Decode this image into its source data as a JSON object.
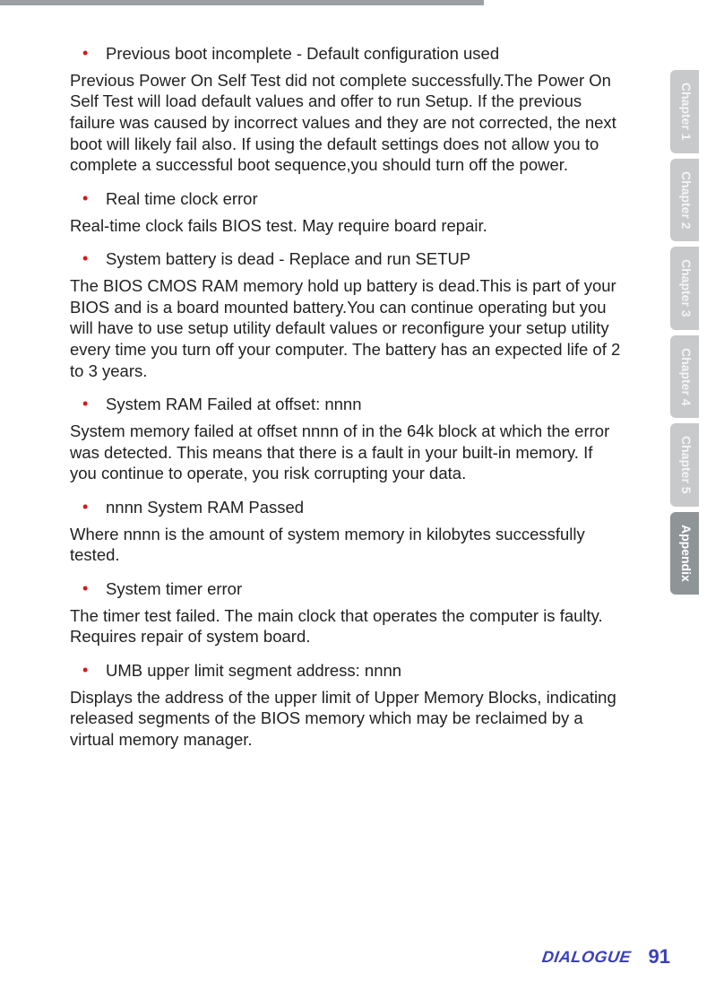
{
  "content": {
    "items": [
      {
        "bullet": "Previous boot incomplete - Default configuration used",
        "para": "Previous Power On Self Test did not complete successfully.The Power On Self Test will load default values and offer to run Setup. If the previous failure was caused by incorrect values and they are not corrected, the next boot will likely fail also. If using the default settings does not allow you to complete a successful boot sequence,you should turn off the power."
      },
      {
        "bullet": "Real time clock error",
        "para": "Real-time clock fails BIOS test. May require board repair."
      },
      {
        "bullet": "System battery is dead - Replace and run SETUP",
        "para": "The BIOS CMOS RAM memory hold up battery is dead.This is part of your BIOS and is a board mounted battery.You can continue operating but you will have to use setup utility default values or reconfigure your setup utility every time you turn off your computer. The battery has an expected life of 2 to 3 years."
      },
      {
        "bullet": "System RAM Failed at offset: nnnn",
        "para": "System memory failed at offset nnnn of in the 64k block at which the error was detected. This means that there is a fault in your built-in memory. If you continue to operate, you risk corrupting your data."
      },
      {
        "bullet": "nnnn System RAM Passed",
        "para": "Where nnnn is the amount of system memory in kilobytes successfully tested."
      },
      {
        "bullet": "System timer error",
        "para": "The timer test failed. The main clock that operates the computer is faulty. Requires repair of system board."
      },
      {
        "bullet": "UMB upper limit segment address: nnnn",
        "para": "Displays the address of the upper limit of Upper Memory Blocks, indicating released segments of the BIOS memory which may be reclaimed by a virtual memory manager."
      }
    ]
  },
  "tabs": [
    {
      "label": "Chapter 1",
      "active": false
    },
    {
      "label": "Chapter 2",
      "active": false
    },
    {
      "label": "Chapter 3",
      "active": false
    },
    {
      "label": "Chapter 4",
      "active": false
    },
    {
      "label": "Chapter 5",
      "active": false
    },
    {
      "label": "Appendix",
      "active": true
    }
  ],
  "footer": {
    "brand": "DIALOGUE",
    "page": "91"
  }
}
